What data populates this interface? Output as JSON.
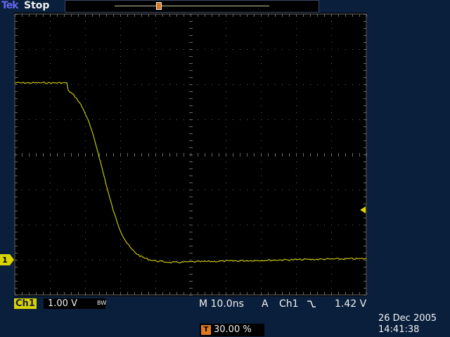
{
  "header": {
    "brand": "Tek",
    "run_status": "Stop"
  },
  "channel": {
    "badge": "Ch1",
    "scale": "1.00 V",
    "bw_limit": "BW",
    "ground_marker": "1",
    "trace_color": "#d9d300"
  },
  "timebase": {
    "label": "M 10.0ns"
  },
  "trigger": {
    "mode": "A",
    "source": "Ch1",
    "slope_icon": "falling-edge-icon",
    "level": "1.42 V",
    "marker_color": "#e07a20"
  },
  "horizontal_position": {
    "icon": "T",
    "value": "30.00 %"
  },
  "datetime": {
    "date": "26 Dec 2005",
    "time": "14:41:38"
  }
}
